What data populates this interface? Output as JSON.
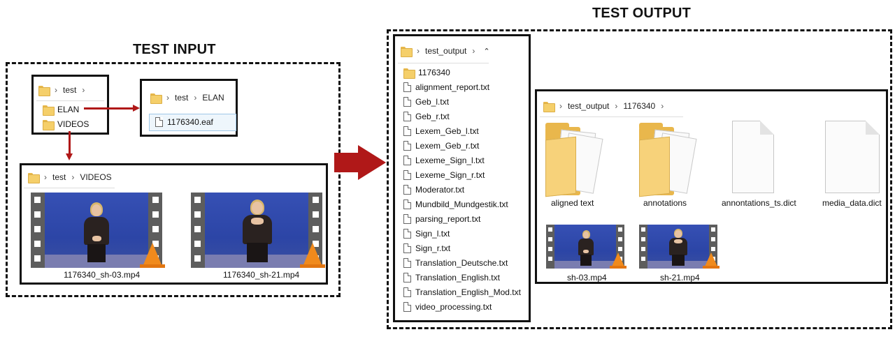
{
  "titles": {
    "input": "TEST INPUT",
    "output": "TEST OUTPUT"
  },
  "input": {
    "test_window": {
      "crumb": [
        "test"
      ],
      "items": [
        "ELAN",
        "VIDEOS"
      ]
    },
    "elan_window": {
      "crumb": [
        "test",
        "ELAN"
      ],
      "items": [
        "1176340.eaf"
      ]
    },
    "videos_window": {
      "crumb": [
        "test",
        "VIDEOS"
      ],
      "items": [
        "1176340_sh-03.mp4",
        "1176340_sh-21.mp4"
      ]
    }
  },
  "output": {
    "list_window": {
      "crumb": [
        "test_output"
      ],
      "folders": [
        "1176340"
      ],
      "files": [
        "alignment_report.txt",
        "Geb_l.txt",
        "Geb_r.txt",
        "Lexem_Geb_l.txt",
        "Lexem_Geb_r.txt",
        "Lexeme_Sign_l.txt",
        "Lexeme_Sign_r.txt",
        "Moderator.txt",
        "Mundbild_Mundgestik.txt",
        "parsing_report.txt",
        "Sign_l.txt",
        "Sign_r.txt",
        "Translation_Deutsche.txt",
        "Translation_English.txt",
        "Translation_English_Mod.txt",
        "video_processing.txt"
      ]
    },
    "detail_window": {
      "crumb": [
        "test_output",
        "1176340"
      ],
      "icons": [
        "aligned text",
        "annotations",
        "annontations_ts.dict",
        "media_data.dict"
      ],
      "videos": [
        "sh-03.mp4",
        "sh-21.mp4"
      ]
    }
  },
  "colors": {
    "arrow": "#b01818",
    "folder": "#f5cf6a",
    "video_bg": "#2c45a6",
    "vlc_cone": "#f08a1c"
  }
}
